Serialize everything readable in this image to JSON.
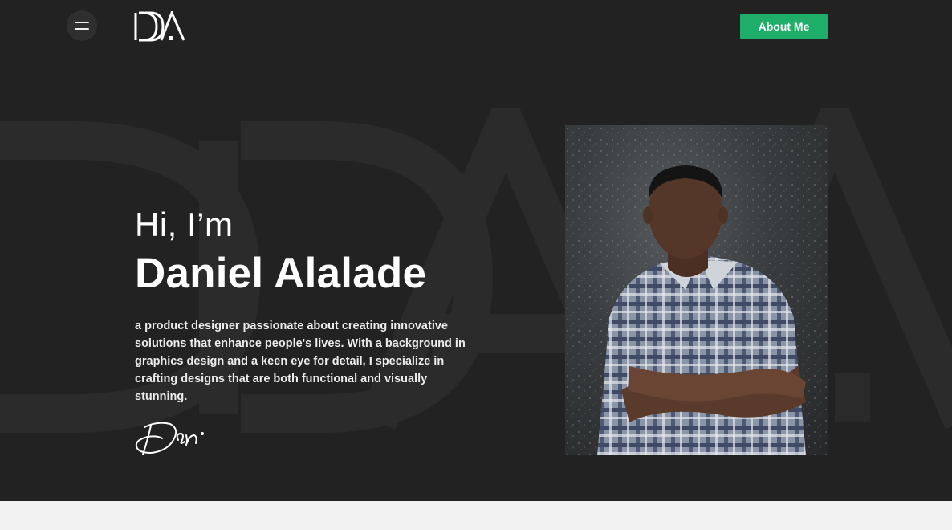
{
  "header": {
    "menu_icon": "hamburger-menu-icon",
    "logo_text": "DA",
    "about_button_label": "About Me"
  },
  "hero": {
    "greeting": "Hi, I’m",
    "name": "Daniel Alalade",
    "bio": "a product designer passionate about creating innovative solutions that enhance people's lives. With a background in graphics design and a keen eye for detail, I specialize in crafting designs that are both functional and visually stunning.",
    "signature": "Dan.",
    "portrait_icon": "portrait-photo"
  },
  "colors": {
    "hero_background": "#222222",
    "accent": "#1fae6a",
    "text": "#ffffff",
    "page_background": "#f2f2f2"
  }
}
